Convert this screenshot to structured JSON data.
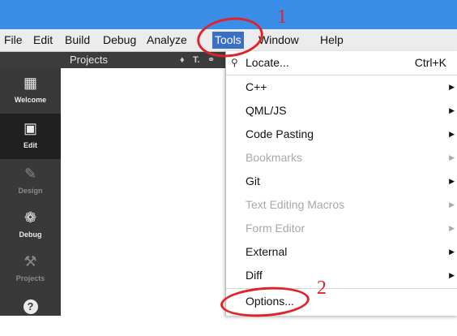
{
  "menubar": {
    "items": [
      {
        "label": "File"
      },
      {
        "label": "Edit"
      },
      {
        "label": "Build"
      },
      {
        "label": "Debug"
      },
      {
        "label": "Analyze"
      },
      {
        "label": "Tools"
      },
      {
        "label": "Window"
      },
      {
        "label": "Help"
      }
    ],
    "active_color": "#3a6fc4"
  },
  "projects_pane": {
    "title": "Projects",
    "filter_icon": "filter-icon",
    "link_icon": "link-icon"
  },
  "sidebar": {
    "items": [
      {
        "label": "Welcome",
        "icon": "grid-icon",
        "state": "normal"
      },
      {
        "label": "Edit",
        "icon": "document-icon",
        "state": "selected"
      },
      {
        "label": "Design",
        "icon": "pencil-icon",
        "state": "disabled"
      },
      {
        "label": "Debug",
        "icon": "bug-icon",
        "state": "normal"
      },
      {
        "label": "Projects",
        "icon": "wrench-icon",
        "state": "disabled"
      },
      {
        "label": "",
        "icon": "help-icon",
        "state": "normal"
      }
    ]
  },
  "tools_menu": {
    "items": [
      {
        "label": "Locate...",
        "shortcut": "Ctrl+K",
        "icon": "search-icon",
        "enabled": true,
        "submenu": false
      },
      {
        "label": "C++",
        "enabled": true,
        "submenu": true
      },
      {
        "label": "QML/JS",
        "enabled": true,
        "submenu": true
      },
      {
        "label": "Code Pasting",
        "enabled": true,
        "submenu": true
      },
      {
        "label": "Bookmarks",
        "enabled": false,
        "submenu": true
      },
      {
        "label": "Git",
        "enabled": true,
        "submenu": true
      },
      {
        "label": "Text Editing Macros",
        "enabled": false,
        "submenu": true
      },
      {
        "label": "Form Editor",
        "enabled": false,
        "submenu": true
      },
      {
        "label": "External",
        "enabled": true,
        "submenu": true
      },
      {
        "label": "Diff",
        "enabled": true,
        "submenu": true
      },
      {
        "label": "Options...",
        "enabled": true,
        "submenu": false
      }
    ]
  },
  "annotations": [
    {
      "number": "1",
      "target": "Tools menu",
      "color": "#e0222a"
    },
    {
      "number": "2",
      "target": "Options...",
      "color": "#e0222a"
    }
  ]
}
